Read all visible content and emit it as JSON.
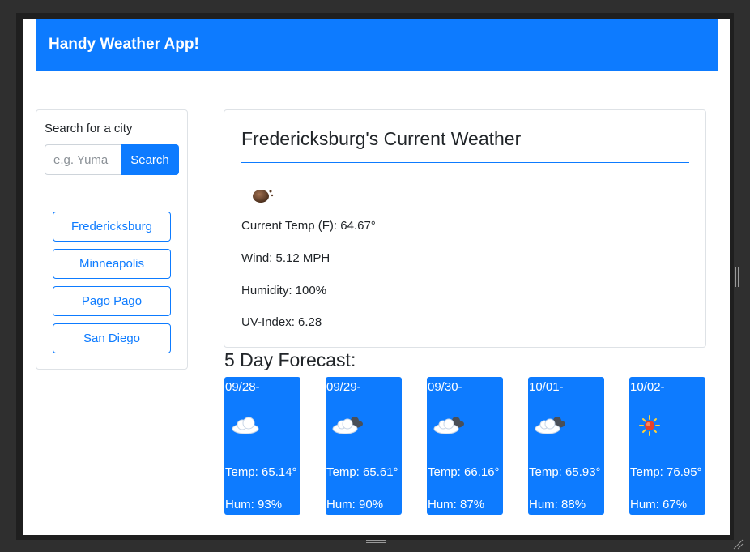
{
  "navbar": {
    "brand": "Handy Weather App!"
  },
  "sidebar": {
    "search_label": "Search for a city",
    "search_placeholder": "e.g. Yuma",
    "search_button": "Search",
    "cities": [
      "Fredericksburg",
      "Minneapolis",
      "Pago Pago",
      "San Diego"
    ]
  },
  "current": {
    "title": "Fredericksburg's Current Weather",
    "icon": "mist-icon",
    "temp": "Current Temp (F): 64.67°",
    "wind": "Wind: 5.12 MPH",
    "humidity": "Humidity: 100%",
    "uv": "UV-Index: 6.28"
  },
  "forecast": {
    "title": "5 Day Forecast:",
    "days": [
      {
        "date": "09/28-",
        "icon": "cloud-icon",
        "temp": "Temp: 65.14°",
        "hum": "Hum: 93%"
      },
      {
        "date": "09/29-",
        "icon": "broken-clouds-icon",
        "temp": "Temp: 65.61°",
        "hum": "Hum: 90%"
      },
      {
        "date": "09/30-",
        "icon": "broken-clouds-icon",
        "temp": "Temp: 66.16°",
        "hum": "Hum: 87%"
      },
      {
        "date": "10/01-",
        "icon": "broken-clouds-icon",
        "temp": "Temp: 65.93°",
        "hum": "Hum: 88%"
      },
      {
        "date": "10/02-",
        "icon": "sun-icon",
        "temp": "Temp: 76.95°",
        "hum": "Hum: 67%"
      }
    ]
  },
  "colors": {
    "primary": "#0d7bff",
    "card_border": "#dee2e6",
    "text": "#212529"
  }
}
